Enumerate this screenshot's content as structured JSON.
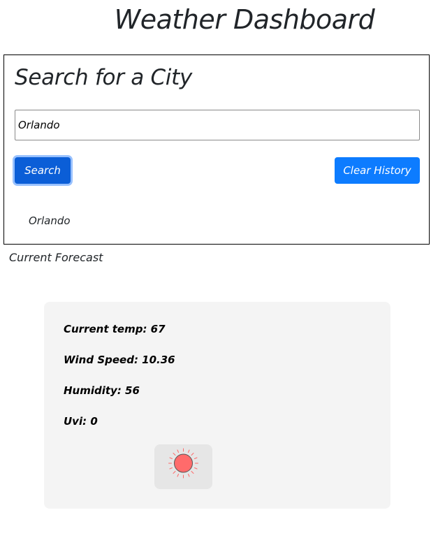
{
  "header": {
    "title": "Weather Dashboard"
  },
  "search": {
    "heading": "Search for a City",
    "input_value": "Orlando",
    "search_button_label": "Search",
    "clear_button_label": "Clear History"
  },
  "history": {
    "items": [
      {
        "label": "Orlando"
      }
    ]
  },
  "forecast": {
    "section_label": "Current Forecast",
    "temp_text": "Current temp: 67",
    "wind_text": "Wind Speed: 10.36",
    "humidity_text": "Humidity: 56",
    "uvi_text": "Uvi: 0",
    "icon": "sun-icon"
  },
  "colors": {
    "primary_button": "#0d6efd",
    "sun": "#ff6b6b",
    "card_background": "#f4f4f4"
  }
}
